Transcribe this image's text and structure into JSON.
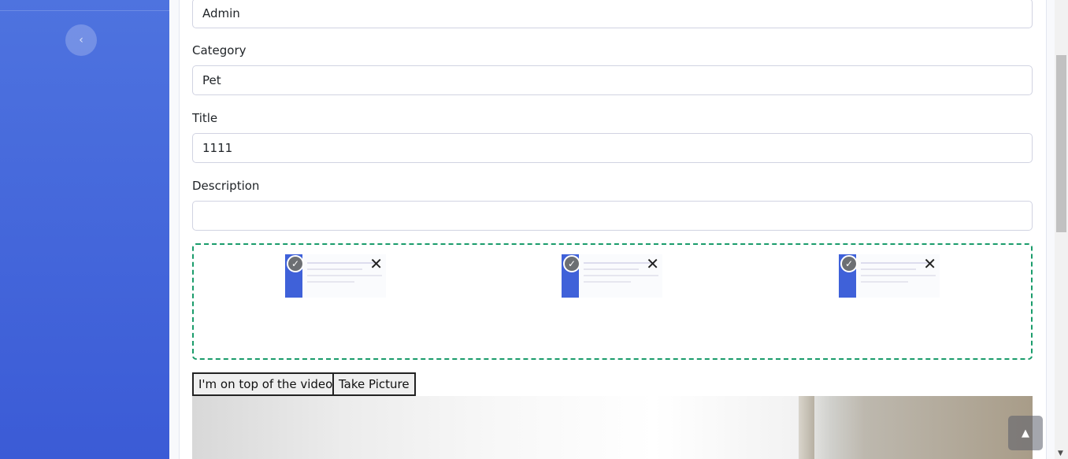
{
  "form": {
    "owner_value": "Admin",
    "category_label": "Category",
    "category_value": "Pet",
    "title_label": "Title",
    "title_value": "1111",
    "description_label": "Description",
    "description_value": ""
  },
  "uploads": {
    "items": [
      {
        "check_icon": "✓",
        "remove_icon": "✕"
      },
      {
        "check_icon": "✓",
        "remove_icon": "✕"
      },
      {
        "check_icon": "✓",
        "remove_icon": "✕"
      }
    ]
  },
  "camera": {
    "overlay_button_label": "I'm on top of the video",
    "take_picture_label": "Take Picture"
  },
  "icons": {
    "sidebar_toggle": "‹",
    "scroll_top": "▲",
    "scroll_down": "▼"
  },
  "colors": {
    "sidebar": "#4e73df",
    "dropzone_border": "#1a9c6b"
  }
}
